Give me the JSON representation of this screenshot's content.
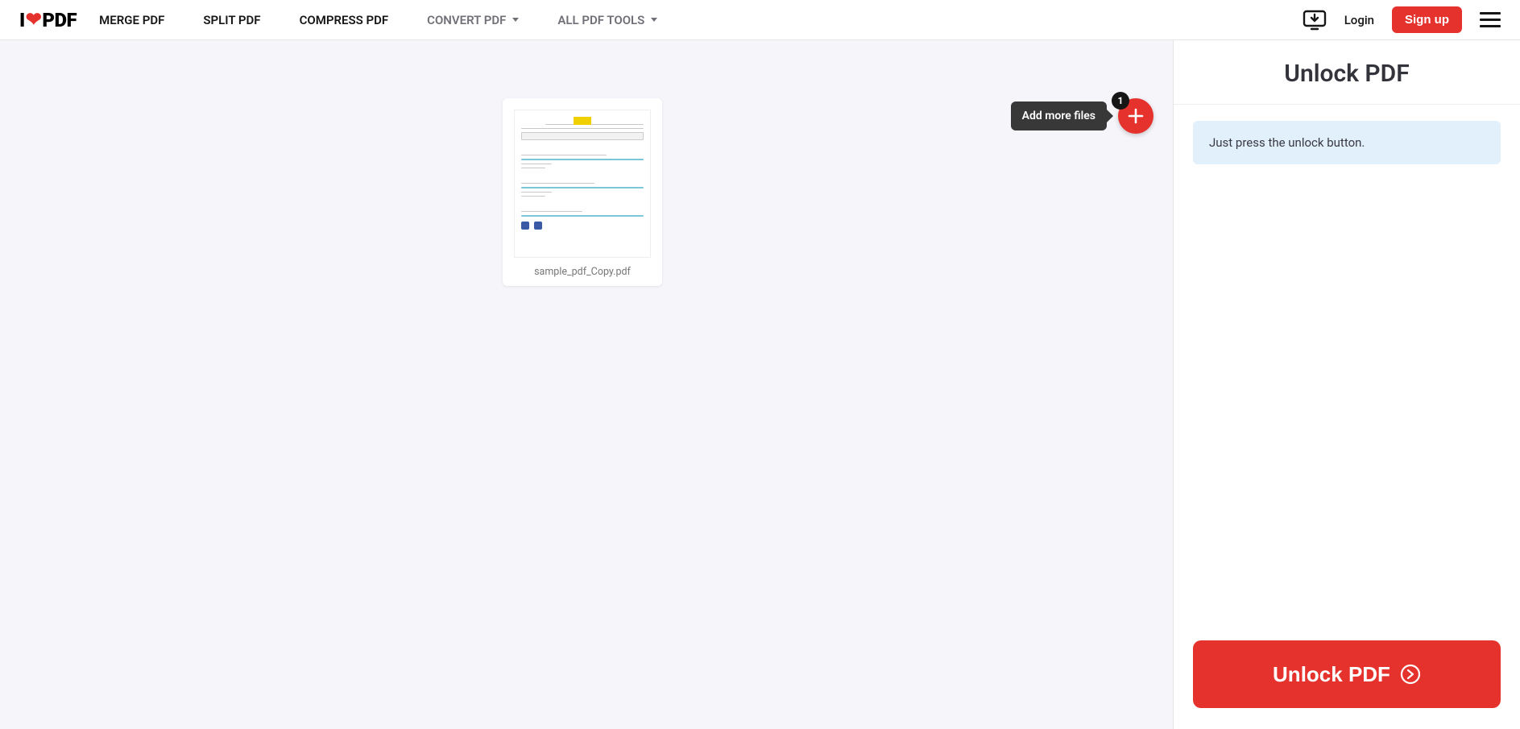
{
  "header": {
    "logo_prefix": "I",
    "logo_suffix": "PDF",
    "nav": {
      "merge": "MERGE PDF",
      "split": "SPLIT PDF",
      "compress": "COMPRESS PDF",
      "convert": "CONVERT PDF",
      "alltools": "ALL PDF TOOLS"
    },
    "login": "Login",
    "signup": "Sign up"
  },
  "main": {
    "file_name": "sample_pdf_Copy.pdf",
    "add_more_tooltip": "Add more files",
    "add_badge": "1"
  },
  "sidebar": {
    "title": "Unlock PDF",
    "info": "Just press the unlock button.",
    "action_label": "Unlock PDF"
  }
}
